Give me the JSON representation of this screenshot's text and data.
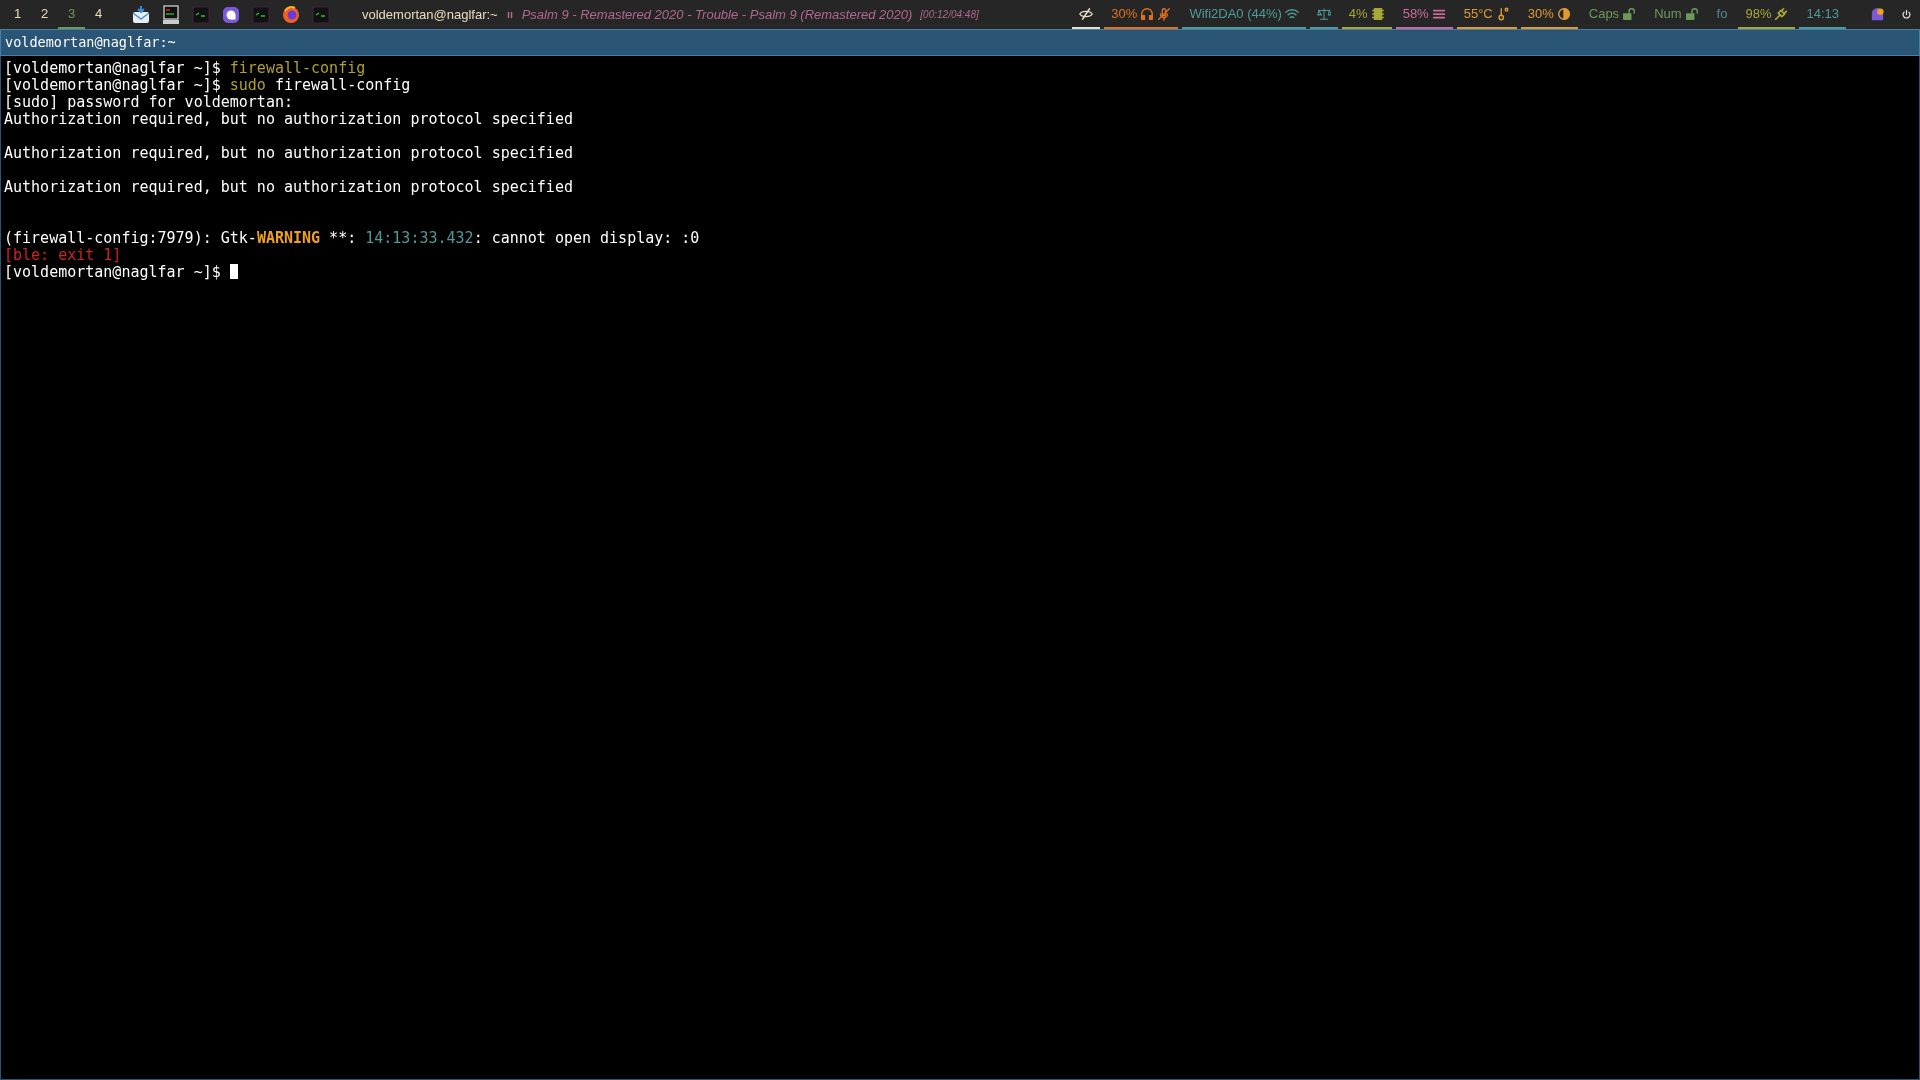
{
  "bar": {
    "workspaces": [
      {
        "label": "1",
        "selected": false
      },
      {
        "label": "2",
        "selected": false
      },
      {
        "label": "3",
        "selected": true
      },
      {
        "label": "4",
        "selected": false
      }
    ],
    "apps": [
      {
        "kind": "mail"
      },
      {
        "kind": "monitor"
      },
      {
        "kind": "terminal"
      },
      {
        "kind": "chat"
      },
      {
        "kind": "terminal"
      },
      {
        "kind": "browser"
      },
      {
        "kind": "terminal"
      }
    ],
    "window_title": "voldemortan@naglfar:~",
    "media": {
      "paused": true,
      "track": "Psalm 9 - Remastered 2020 - Trouble - Psalm 9 (Remastered 2020)",
      "time": "[00:12/04:48]"
    },
    "modules": [
      {
        "kind": "eye",
        "color": "#e8e0c8",
        "underline": true
      },
      {
        "kind": "audio",
        "text": "30%",
        "color": "#e07020",
        "underline": true
      },
      {
        "kind": "wifi",
        "text": "Wifi2DA0 (44%)",
        "color": "#4e9a9a",
        "underline": true
      },
      {
        "kind": "scale",
        "color": "#4e9a9a",
        "underline": true
      },
      {
        "kind": "cpu",
        "text": "4%",
        "color": "#a8a838",
        "underline": true
      },
      {
        "kind": "memory",
        "text": "58%",
        "color": "#c86a9a",
        "underline": true
      },
      {
        "kind": "temp",
        "text": "55°C",
        "color": "#e09a30",
        "underline": true
      },
      {
        "kind": "brightness",
        "text": "30%",
        "color": "#e09a30",
        "underline": true
      },
      {
        "kind": "lock",
        "text": "Caps",
        "color": "#6a9a5a",
        "underline": false
      },
      {
        "kind": "lock",
        "text": "Num",
        "color": "#6a9a5a",
        "underline": false
      },
      {
        "kind": "plain",
        "text": "fo",
        "color": "#4e8a9a",
        "underline": false
      },
      {
        "kind": "plug",
        "text": "98%",
        "color": "#a8a838",
        "underline": true
      },
      {
        "kind": "plain",
        "text": "14:13",
        "color": "#4e9a9a",
        "underline": true
      }
    ],
    "tray": [
      {
        "kind": "tray-app"
      },
      {
        "kind": "power"
      }
    ]
  },
  "terminal": {
    "title": "voldemortan@naglfar:~",
    "lines": [
      [
        {
          "kind": "plain",
          "text": "[voldemortan@naglfar ~]$ "
        },
        {
          "kind": "command",
          "text": "firewall-config"
        }
      ],
      [
        {
          "kind": "plain",
          "text": "[voldemortan@naglfar ~]$ "
        },
        {
          "kind": "command",
          "text": "sudo"
        },
        {
          "kind": "plain",
          "text": " firewall-config"
        }
      ],
      [
        {
          "kind": "plain",
          "text": "[sudo] password for voldemortan:"
        }
      ],
      [
        {
          "kind": "plain",
          "text": "Authorization required, but no authorization protocol specified"
        }
      ],
      [
        {
          "kind": "blank"
        }
      ],
      [
        {
          "kind": "plain",
          "text": "Authorization required, but no authorization protocol specified"
        }
      ],
      [
        {
          "kind": "blank"
        }
      ],
      [
        {
          "kind": "plain",
          "text": "Authorization required, but no authorization protocol specified"
        }
      ],
      [
        {
          "kind": "blank"
        }
      ],
      [
        {
          "kind": "blank"
        }
      ],
      [
        {
          "kind": "plain",
          "text": "(firewall-config:7979): Gtk-"
        },
        {
          "kind": "warning",
          "text": "WARNING"
        },
        {
          "kind": "plain",
          "text": " **: "
        },
        {
          "kind": "timestamp",
          "text": "14:13:33.432"
        },
        {
          "kind": "plain",
          "text": ": cannot open display: :0"
        }
      ],
      [
        {
          "kind": "error",
          "text": "[ble: exit 1]"
        }
      ],
      [
        {
          "kind": "plain",
          "text": "[voldemortan@naglfar ~]$ "
        },
        {
          "kind": "cursor"
        }
      ]
    ]
  }
}
